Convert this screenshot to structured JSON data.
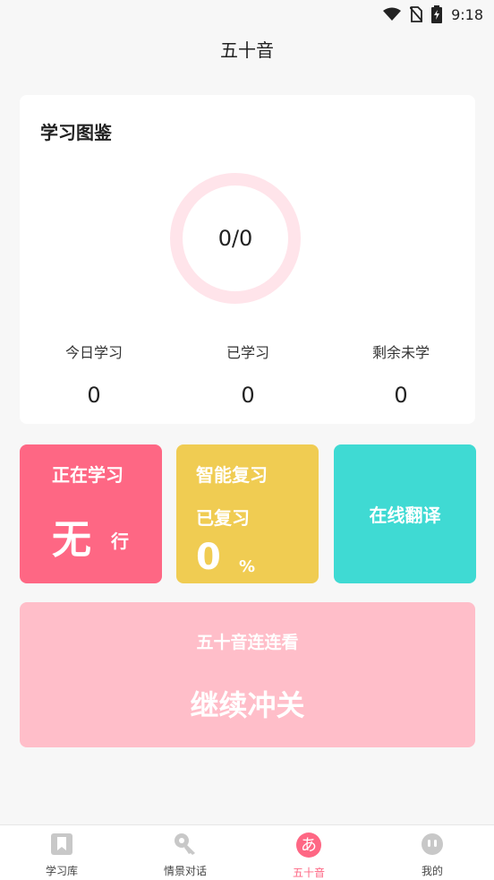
{
  "status": {
    "time": "9:18"
  },
  "header": {
    "title": "五十音"
  },
  "study_card": {
    "title": "学习图鉴",
    "progress_text": "0/0",
    "stats": [
      {
        "label": "今日学习",
        "value": "0"
      },
      {
        "label": "已学习",
        "value": "0"
      },
      {
        "label": "剩余未学",
        "value": "0"
      }
    ]
  },
  "tiles": {
    "studying": {
      "title": "正在学习",
      "big": "无",
      "small": "行"
    },
    "review": {
      "title": "智能复习",
      "sub": "已复习",
      "value": "0",
      "unit": "%"
    },
    "translate": {
      "label": "在线翻译"
    }
  },
  "banner": {
    "subtitle": "五十音连连看",
    "main": "继续冲关"
  },
  "nav": {
    "items": [
      {
        "label": "学习库",
        "icon": "bookmark-icon"
      },
      {
        "label": "情景对话",
        "icon": "key-icon"
      },
      {
        "label": "五十音",
        "icon": "hiragana-a-icon",
        "glyph": "あ"
      },
      {
        "label": "我的",
        "icon": "face-icon"
      }
    ],
    "active_index": 2
  },
  "colors": {
    "pink": "#fe6784",
    "yellow": "#f0cc52",
    "teal": "#3fdad3",
    "banner_pink": "#ffbec9",
    "ring": "#ffe4ea"
  }
}
